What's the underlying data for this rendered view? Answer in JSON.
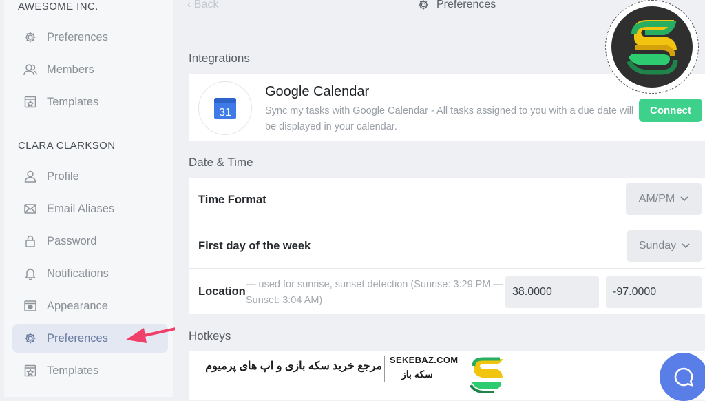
{
  "sidebar": {
    "org_title": "AWESOME INC.",
    "user_title": "CLARA CLARKSON",
    "org_items": [
      {
        "label": "Preferences",
        "icon": "gear-icon"
      },
      {
        "label": "Members",
        "icon": "users-icon"
      },
      {
        "label": "Templates",
        "icon": "template-star-icon"
      }
    ],
    "user_items": [
      {
        "label": "Profile",
        "icon": "person-icon"
      },
      {
        "label": "Email Aliases",
        "icon": "envelope-icon"
      },
      {
        "label": "Password",
        "icon": "lock-icon"
      },
      {
        "label": "Notifications",
        "icon": "bell-icon"
      },
      {
        "label": "Appearance",
        "icon": "appearance-icon"
      },
      {
        "label": "Preferences",
        "icon": "gear-icon",
        "active": true
      },
      {
        "label": "Templates",
        "icon": "template-star-icon"
      }
    ]
  },
  "header": {
    "back_label": "Back",
    "title": "Preferences"
  },
  "integrations": {
    "section_label": "Integrations",
    "google_calendar": {
      "calendar_day": "31",
      "title": "Google Calendar",
      "description": "Sync my tasks with Google Calendar - All tasks assigned to you with a due date will be displayed in your calendar.",
      "connect_label": "Connect"
    }
  },
  "date_time": {
    "section_label": "Date & Time",
    "time_format": {
      "label": "Time Format",
      "value": "AM/PM"
    },
    "first_day": {
      "label": "First day of the week",
      "value": "Sunday"
    },
    "location": {
      "label": "Location",
      "description": "— used for sunrise, sunset detection (Sunrise: 3:29 PM — Sunset: 3:04 AM)",
      "latitude": "38.0000",
      "longitude": "-97.0000"
    }
  },
  "hotkeys": {
    "section_label": "Hotkeys"
  },
  "watermark": {
    "domain": "SEKEBAZ.COM",
    "name_fa": "سکه باز",
    "tagline_fa": "مرجع خرید سکه بازی و اپ های پرمیوم"
  },
  "colors": {
    "accent": "#3ed18c",
    "active_nav": "#e3e8f3",
    "chat_button": "#5a7ee8",
    "annotation_arrow": "#f0406a"
  }
}
